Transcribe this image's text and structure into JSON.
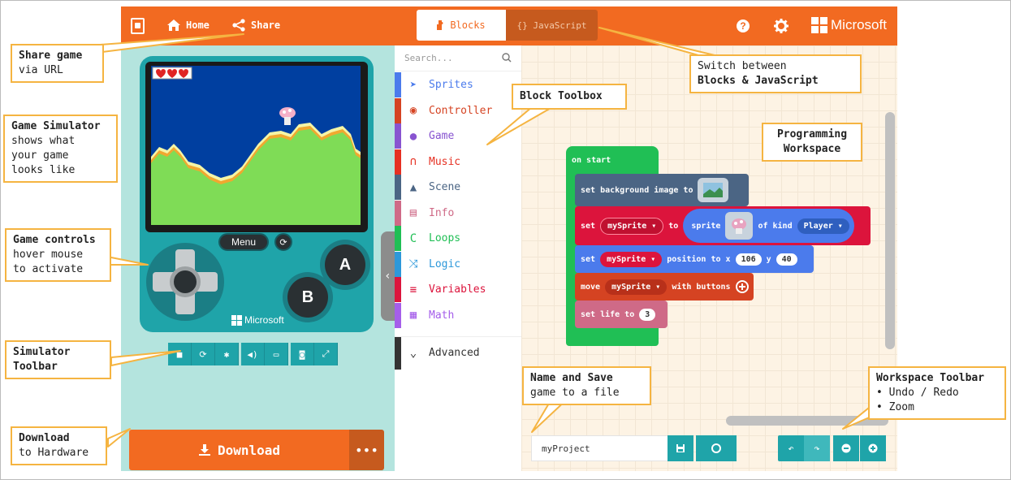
{
  "header": {
    "home_label": "Home",
    "share_label": "Share",
    "blocks_tab": "Blocks",
    "js_tab": "{} JavaScript",
    "brand": "Microsoft",
    "help_icon": "help-circle-icon",
    "settings_icon": "gear-icon"
  },
  "simulator": {
    "menu_label": "Menu",
    "a_label": "A",
    "b_label": "B",
    "device_brand": "Microsoft",
    "hearts": 3,
    "toolbar_icons": [
      "stop-icon",
      "restart-icon",
      "debug-icon",
      "mute-icon",
      "keyboard-icon",
      "screenshot-icon",
      "fullscreen-icon"
    ],
    "download_label": "Download",
    "more_label": "•••"
  },
  "toolbox": {
    "search_placeholder": "Search...",
    "categories": [
      {
        "label": "Sprites",
        "color": "#4b7bec",
        "icon": "paper-plane-icon"
      },
      {
        "label": "Controller",
        "color": "#d54322",
        "icon": "gamepad-icon"
      },
      {
        "label": "Game",
        "color": "#8854d0",
        "icon": "circle-icon"
      },
      {
        "label": "Music",
        "color": "#e63022",
        "icon": "headphones-icon"
      },
      {
        "label": "Scene",
        "color": "#4b6584",
        "icon": "tree-icon"
      },
      {
        "label": "Info",
        "color": "#cf6a87",
        "icon": "id-card-icon"
      },
      {
        "label": "Loops",
        "color": "#20bf55",
        "icon": "loop-icon"
      },
      {
        "label": "Logic",
        "color": "#2d98da",
        "icon": "shuffle-icon"
      },
      {
        "label": "Variables",
        "color": "#dc143c",
        "icon": "list-icon"
      },
      {
        "label": "Math",
        "color": "#a55eea",
        "icon": "calculator-icon"
      }
    ],
    "advanced_label": "Advanced"
  },
  "workspace": {
    "on_start": "on start",
    "set_bg": "set background image to",
    "set_label": "set",
    "sprite_var": "mySprite ▾",
    "to_label": "to",
    "sprite_label": "sprite",
    "of_kind": "of kind",
    "kind": "Player ▾",
    "position_to_x": "position to x",
    "x_val": "106",
    "y_label": "y",
    "y_val": "40",
    "move_label": "move",
    "with_buttons": "with buttons",
    "set_life": "set life to",
    "life_val": "3",
    "project_name": "myProject",
    "colors": {
      "green": "#20bf55",
      "blue": "#4b7bec",
      "red": "#dc143c",
      "scene_blue": "#4b6584",
      "controller": "#d54322",
      "info": "#cf6a87"
    }
  },
  "callouts": {
    "share_title": "Share game",
    "share_body": "via URL",
    "switch_body": "Switch between",
    "switch_title": "Blocks & JavaScript",
    "toolbox_title": "Block Toolbox",
    "sim_title": "Game Simulator",
    "sim_body1": "shows what",
    "sim_body2": "your game",
    "sim_body3": "looks like",
    "workspace_title1": "Programming",
    "workspace_title2": "Workspace",
    "controls_title": "Game controls",
    "controls_body1": "hover mouse",
    "controls_body2": "to activate",
    "simtb_title1": "Simulator",
    "simtb_title2": "Toolbar",
    "save_title": "Name and Save",
    "save_body": "game to a file",
    "wstb_title": "Workspace Toolbar",
    "wstb_item1": "• Undo / Redo",
    "wstb_item2": "• Zoom",
    "download_title": "Download",
    "download_body": "to Hardware"
  }
}
